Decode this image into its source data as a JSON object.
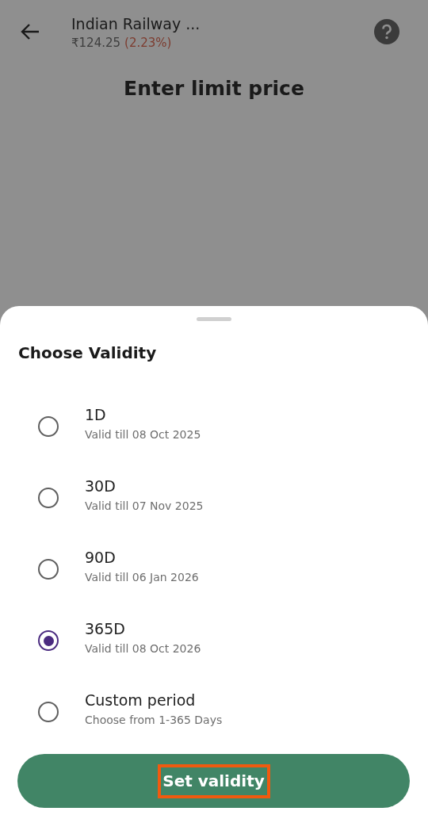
{
  "header": {
    "title": "Indian Railway ...",
    "price": "₹124.25",
    "change": "(2.23%)"
  },
  "page_title": "Enter limit price",
  "sheet": {
    "title": "Choose Validity",
    "options": [
      {
        "label": "1D",
        "sublabel": "Valid till 08 Oct 2025",
        "selected": false
      },
      {
        "label": "30D",
        "sublabel": "Valid till 07 Nov 2025",
        "selected": false
      },
      {
        "label": "90D",
        "sublabel": "Valid till 06 Jan 2026",
        "selected": false
      },
      {
        "label": "365D",
        "sublabel": "Valid till 08 Oct 2026",
        "selected": true
      },
      {
        "label": "Custom period",
        "sublabel": "Choose from 1-365 Days",
        "selected": false
      }
    ],
    "button": {
      "label": "Set validity",
      "highlighted": true
    }
  }
}
